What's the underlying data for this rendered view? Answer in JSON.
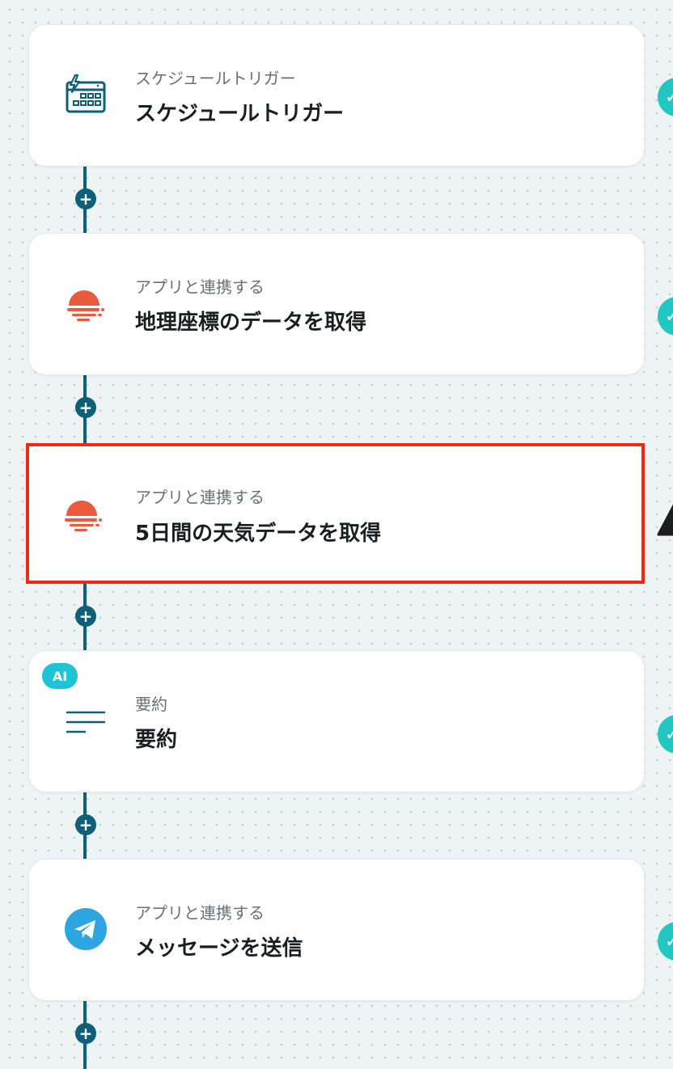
{
  "flow": {
    "steps": [
      {
        "kind": "trigger",
        "subtitle": "スケジュールトリガー",
        "title": "スケジュールトリガー",
        "icon": "calendar-bolt-icon",
        "status": "complete"
      },
      {
        "kind": "app",
        "subtitle": "アプリと連携する",
        "title": "地理座標のデータを取得",
        "icon": "openweather-icon",
        "status": "complete"
      },
      {
        "kind": "app",
        "subtitle": "アプリと連携する",
        "title": "5日間の天気データを取得",
        "icon": "openweather-icon",
        "status": "warning",
        "selected": true
      },
      {
        "kind": "ai",
        "badge": "AI",
        "subtitle": "要約",
        "title": "要約",
        "icon": "text-lines-icon",
        "status": "complete"
      },
      {
        "kind": "app",
        "subtitle": "アプリと連携する",
        "title": "メッセージを送信",
        "icon": "telegram-icon",
        "status": "complete"
      }
    ],
    "add_symbol": "+"
  },
  "colors": {
    "connector": "#0e5f78",
    "selected_border": "#ee2a14",
    "openweather": "#ea5a3f",
    "ai_badge": "#1cc4d6",
    "status_ok": "#23c7c1",
    "telegram": "#2ca5e0"
  }
}
